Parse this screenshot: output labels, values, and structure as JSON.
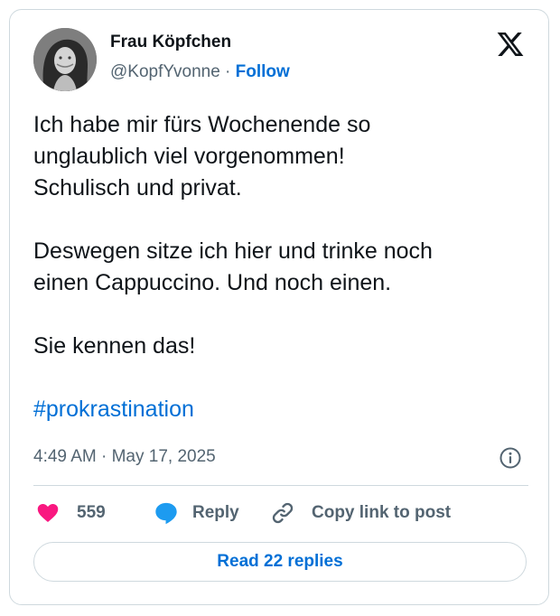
{
  "author": {
    "name": "Frau Köpfchen",
    "handle": "@KopfYvonne",
    "separator": "·",
    "follow_label": "Follow",
    "avatar_icon": "profile-photo"
  },
  "platform_icon": "x-logo-icon",
  "tweet": {
    "lines_p1": [
      "Ich habe mir fürs Wochenende so",
      "unglaublich viel vorgenommen!",
      "Schulisch und privat."
    ],
    "lines_p2": [
      "Deswegen sitze ich hier und trinke noch",
      "einen Cappuccino. Und noch einen."
    ],
    "lines_p3": [
      "Sie kennen das!"
    ],
    "hashtag": "#prokrastination"
  },
  "meta": {
    "timestamp": "4:49 AM · May 17, 2025",
    "info_icon": "info-icon"
  },
  "actions": {
    "like_count": "559",
    "reply_label": "Reply",
    "copy_link_label": "Copy link to post"
  },
  "footer": {
    "read_replies_label": "Read 22 replies"
  },
  "colors": {
    "link": "#006fd6",
    "heart": "#f91880",
    "reply_bubble": "#1d9bf0",
    "secondary_text": "#536471",
    "border": "#cfd9de"
  }
}
